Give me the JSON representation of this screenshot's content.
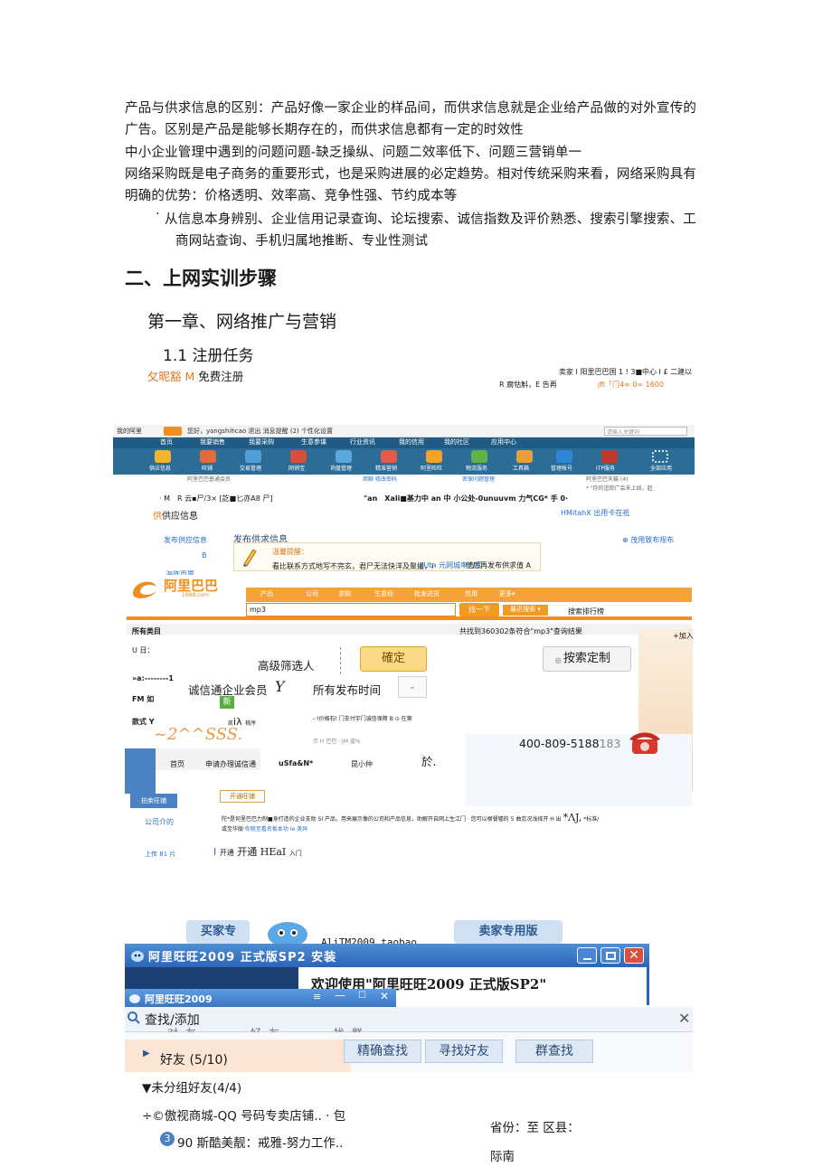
{
  "paragraphs": {
    "p1_line1": "产品与供求信息的区别：产品好像一家企业的样品间，而供求信息就是企业给产品做的对外宣传的",
    "p1_line2": "广告。区别是产品是能够长期存在的，而供求信息都有一定的时效性",
    "p2": "中小企业管理中遇到的问题问题-缺乏操纵、问题二效率低下、问题三营销单一",
    "p3_line1": "网络采购既是电子商务的重要形式，也是采购进展的必定趋势。相对传统采购来看，网络采购具有",
    "p3_line2": "明确的优势：价格透明、效率高、竞争性强、节约成本等",
    "bullet_line1": "从信息本身辨别、企业信用记录查询、论坛搜索、诚信指数及评价熟悉、搜索引擎搜索、工",
    "bullet_line2": "商网站查询、手机归属地推断、专业性测试"
  },
  "headings": {
    "section": "二、上网实训步骤",
    "chapter": "第一章、网络推广与营销",
    "sub": "1.1 注册任务"
  },
  "collage": {
    "reg_label_orange": "攵昵豁 M",
    "reg_label": "免费注册",
    "top_right_line1": "卖家 I 阳里巴巴国 1 ! 3■中心 I £ 二建以",
    "top_right_line2a": "R 腐牯斛，E 告再",
    "top_right_line2b": "jft「门4∞ 0∞ 1600",
    "ali_top_left": "我的阿里",
    "ali_top_user": "您好，yangshihcao  退出  消息提醒 (2)  个性化设置",
    "ali_top_search": "请输入关键词",
    "nav_items": [
      "首页",
      "我要销售",
      "我要采购",
      "生意参谋",
      "行业资讯",
      "我的信用",
      "我的社区",
      "应用中心"
    ],
    "tool_items": [
      "供应信息",
      "旺铺",
      "交易管理",
      "网销宝",
      "询盘管理",
      "精准营销",
      "阿里旺旺",
      "物流服务",
      "工具箱",
      "管理帐号",
      "ITP服务",
      "全部应用"
    ],
    "ali_sub_left": "阿里巴巴普通会员",
    "ali_sub_mid": "商聊  修改密码",
    "ali_sub_mid2": "密保问题管理",
    "ali_sub_right": "阿里巴巴天猫 (4)",
    "ali_sub_right2": "* \"你的追踪广会未上线，赶",
    "row1_left": "· M　R 云▪尸/3× [訖■匕亦A8 尸]",
    "row1_mid": "\"an　Xali■基力中 an 中 小公处-0unuuvm 力气CG* 手 0·",
    "supply_icon": "供",
    "supply_text": "供应信息",
    "hmitah": "HMitahX 出用卡在祇",
    "publish_left": "发布供应信息",
    "publish_title": "发布供求信息",
    "publish_right": "⊕ 茂用致布规布",
    "b_letter": "B",
    "tip_label": "温馨提醒：",
    "tip_text": "看比联系方式地写不完玄，君尸无法快洋及聚撮，i·",
    "tip_link": "XUtn 元网城率方式",
    "tip_tail": "他后再发布供求值 A",
    "cut_label": "海阵页票",
    "logo_text": "阿里巴巴",
    "logo_sub": "1688.com",
    "tabs": [
      "产品",
      "公司",
      "求购",
      "生意经",
      "批发进货",
      "信用",
      "更多▾"
    ],
    "search_value": "mp3",
    "find_btn": "找一下",
    "recent_search": "最近搜索 ▾",
    "rank": "搜索排行榜",
    "result_left": "所有类目",
    "result_count": "共找到360302条符合\"mp3\"查询结果",
    "join": "+加入",
    "u_label": "U 日：",
    "advanced": "高级筛选人",
    "confirm": "確定",
    "custom_search": "按索定制",
    "dash_label": "»a:--------1",
    "cx_member": "诚信通企业会员",
    "cx_y": "Y",
    "all_time": "所有发布时间",
    "fm_label": "FM 如",
    "new_badge": "新",
    "style_label": "款式 Y",
    "i_lambda": "iλ",
    "i_lambda_small": "桃序",
    "price_text": "-·!价格石! 门支付宇门诚信保障 B ⊙ 在第",
    "big_italic": "~2^^SSS.",
    "alibaba_jm": "示 H 巴巴 · JM 盗%",
    "phone": "400-809-5188",
    "phone_tail": "183",
    "usfa": "uSfa&N*",
    "yu": "於.",
    "small_pin": "昆小仲",
    "apply_left": "申请办理诚信通",
    "home": "首页",
    "open_btn": "开通旺铺",
    "cut_label2": "拍卖旺铺",
    "company_intro": "公司介的",
    "desc_line1": "陀*是何里巴巴力制■身打造的企业支助 Sl 产品，用来展示像的公司和产品信息，助解开自网上生江门 · 您可以根餐辐的 5 曲恋况浅择开 H 出",
    "desc_line1_b": "*ΛJ,",
    "desc_line1_c": "*标准/",
    "desc_line2": "或至华版·",
    "desc_link": "你就至看名板本功 Ie 美异",
    "upload": "上传 81 片",
    "open_heal": "开通 HEaI",
    "open_heal_tail": "入门"
  },
  "wangwang": {
    "seller_left": "买家专",
    "ali_tm": "AliTM2009 taobao",
    "seller_right": "卖家专用版",
    "install_title": "阿里旺旺2009 正式版SP2 安装",
    "welcome": "欢迎使用\"阿里旺旺2009 正式版SP2\"",
    "ww2_title": "阿里旺旺2009",
    "find_title": "查找/添加",
    "find_tabs": [
      "对友",
      "好友",
      "找群"
    ],
    "friends": "好友 (5/10)",
    "tab_precise": "精确查找",
    "tab_find_friends": "寻找好友",
    "tab_group": "群查找",
    "ungrouped": "▼未分组好友(4/4)",
    "friend1": "÷©傲视商城-QQ 号码专卖店铺.. · 包",
    "friend2_num": "3",
    "friend2": "90 斯酷美靓：戒雅-努力工作..",
    "province": "省份：至 区县：",
    "area": "际南"
  },
  "colors": {
    "orange_accent": "#e0781e",
    "ali_blue": "#2c6d98",
    "ali_orange": "#f18e20",
    "ww_blue": "#2d64b8"
  }
}
